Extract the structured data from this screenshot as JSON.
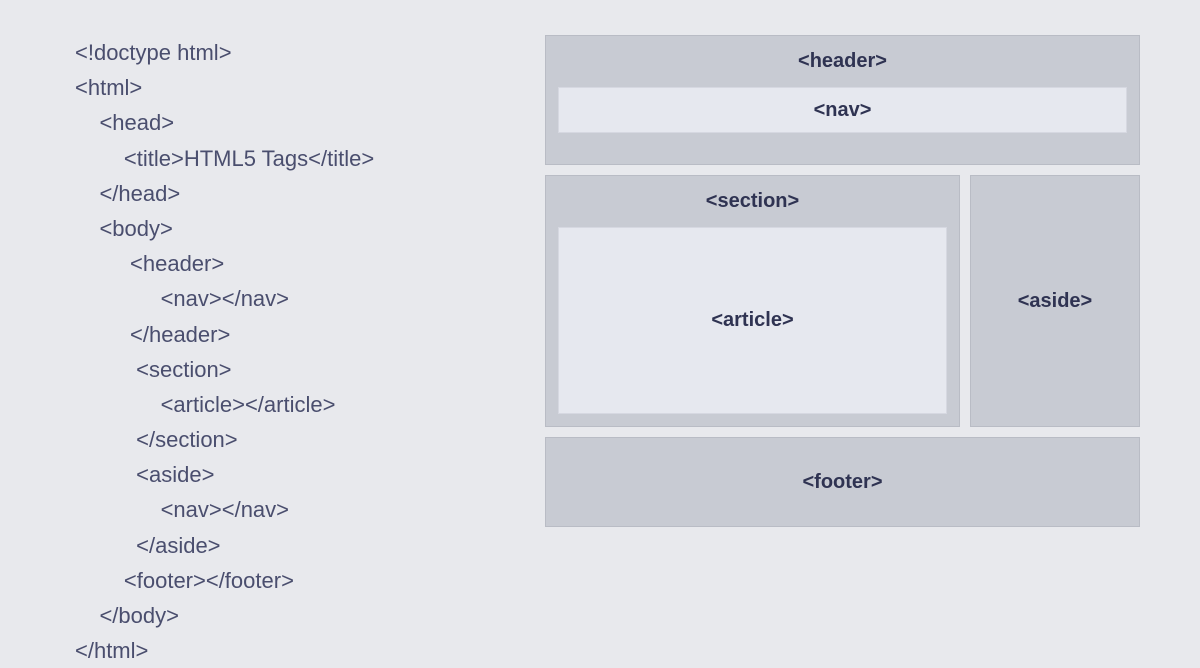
{
  "code": {
    "lines": [
      "<!doctype html>",
      "<html>",
      "    <head>",
      "        <title>HTML5 Tags</title>",
      "    </head>",
      "    <body>",
      "         <header>",
      "              <nav></nav>",
      "         </header>",
      "          <section>",
      "              <article></article>",
      "          </section>",
      "          <aside>",
      "              <nav></nav>",
      "          </aside>",
      "        <footer></footer>",
      "    </body>",
      "</html>"
    ]
  },
  "diagram": {
    "header_label": "<header>",
    "nav_label": "<nav>",
    "section_label": "<section>",
    "article_label": "<article>",
    "aside_label": "<aside>",
    "footer_label": "<footer>"
  }
}
